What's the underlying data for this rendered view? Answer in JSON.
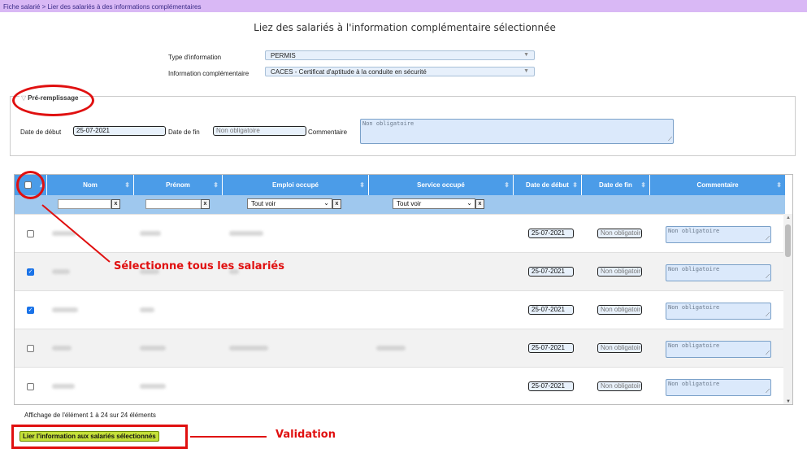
{
  "breadcrumb": "Fiche salarié > Lier des salariés à des informations complémentaires",
  "page_title": "Liez des salariés à l'information complémentaire sélectionnée",
  "form": {
    "type_label": "Type d'information",
    "type_value": "PERMIS",
    "info_label": "Information complémentaire",
    "info_value": "CACES  -  Certificat d'aptitude à la conduite en sécurité"
  },
  "prefill": {
    "legend": "Pré-remplissage",
    "date_debut_label": "Date de début",
    "date_debut_value": "25-07-2021",
    "date_fin_label": "Date de fin",
    "date_fin_placeholder": "Non obligatoire",
    "commentaire_label": "Commentaire",
    "commentaire_placeholder": "Non obligatoire"
  },
  "table": {
    "columns": [
      "Nom",
      "Prénom",
      "Emploi occupé",
      "Service occupé",
      "Date de début",
      "Date de fin",
      "Commentaire"
    ],
    "filter_x": "x",
    "filter_select": "Tout voir",
    "rows": [
      {
        "checked": false,
        "date_debut": "25-07-2021",
        "date_fin": "Non obligatoire",
        "commentaire": "Non obligatoire"
      },
      {
        "checked": true,
        "date_debut": "25-07-2021",
        "date_fin": "Non obligatoire",
        "commentaire": "Non obligatoire"
      },
      {
        "checked": true,
        "date_debut": "25-07-2021",
        "date_fin": "Non obligatoire",
        "commentaire": "Non obligatoire"
      },
      {
        "checked": false,
        "date_debut": "25-07-2021",
        "date_fin": "Non obligatoire",
        "commentaire": "Non obligatoire"
      },
      {
        "checked": false,
        "date_debut": "25-07-2021",
        "date_fin": "Non obligatoire",
        "commentaire": "Non obligatoire"
      }
    ]
  },
  "footer": {
    "info": "Affichage de l'élément 1 à 24 sur 24 éléments",
    "submit_label": "Lier l'information aux salariés sélectionnés"
  },
  "annotations": {
    "select_all": "Sélectionne tous les salariés",
    "validation": "Validation"
  },
  "colors": {
    "header": "#4b9ce8",
    "filter_row": "#9fc8ee",
    "annotation": "#e01010",
    "breadcrumb_bg": "#d9b8f5"
  }
}
